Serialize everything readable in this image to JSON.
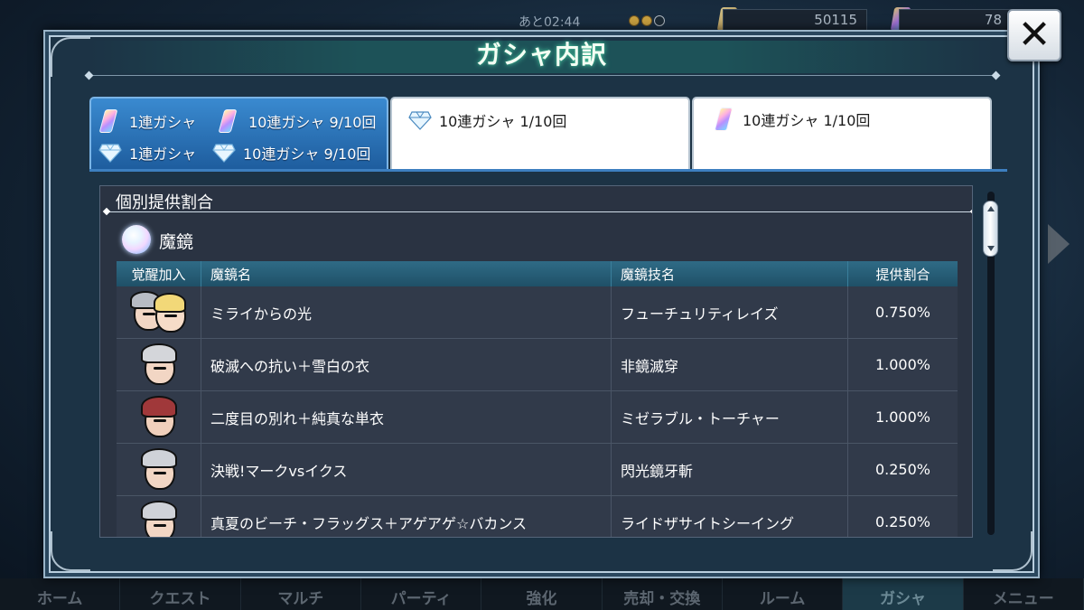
{
  "background": {
    "timer": "あと02:44",
    "counter_1": "50115",
    "counter_2": "78",
    "nav": [
      "ホーム",
      "クエスト",
      "マルチ",
      "パーティ",
      "強化",
      "売却・交換",
      "ルーム",
      "ガシャ",
      "メニュー"
    ],
    "nav_active_index": 7
  },
  "modal": {
    "title": "ガシャ内訳",
    "close_label": "✕"
  },
  "tabs": [
    {
      "active": true,
      "lines": [
        [
          {
            "icon": "prism-icon",
            "text": "1連ガシャ"
          },
          {
            "icon": "prism-icon",
            "text": "10連ガシャ 9/10回"
          }
        ],
        [
          {
            "icon": "diamond-icon",
            "text": "1連ガシャ"
          },
          {
            "icon": "diamond-icon",
            "text": "10連ガシャ 9/10回"
          }
        ]
      ]
    },
    {
      "active": false,
      "lines": [
        [
          {
            "icon": "diamond-icon",
            "text": "10連ガシャ 1/10回"
          }
        ]
      ]
    },
    {
      "active": false,
      "lines": [
        [
          {
            "icon": "prism-icon",
            "text": "10連ガシャ 1/10回"
          }
        ]
      ]
    }
  ],
  "section": {
    "title": "個別提供割合",
    "subsection_title": "魔鏡",
    "columns": [
      "覚醒加入",
      "魔鏡名",
      "魔鏡技名",
      "提供割合"
    ],
    "rows": [
      {
        "portrait": "duo-portrait-icon",
        "name": "ミライからの光",
        "skill": "フューチュリティレイズ",
        "rate": "0.750%"
      },
      {
        "portrait": "silver-hair-portrait-icon",
        "name": "破滅への抗い＋雪白の衣",
        "skill": "非鏡滅穿",
        "rate": "1.000%"
      },
      {
        "portrait": "red-hair-portrait-icon",
        "name": "二度目の別れ＋純真な単衣",
        "skill": "ミゼラブル・トーチャー",
        "rate": "1.000%"
      },
      {
        "portrait": "silver-hair-portrait-icon",
        "name": "決戦!マークvsイクス",
        "skill": "閃光鏡牙斬",
        "rate": "0.250%"
      },
      {
        "portrait": "silver-hair-portrait-icon",
        "name": "真夏のビーチ・フラッグス＋アゲアゲ☆バカンス",
        "skill": "ライドザサイトシーイング",
        "rate": "0.250%"
      }
    ]
  },
  "colors": {
    "active_tab": "#1e5d9e",
    "header_row": "#2f6b86",
    "panel": "#2a3342"
  }
}
